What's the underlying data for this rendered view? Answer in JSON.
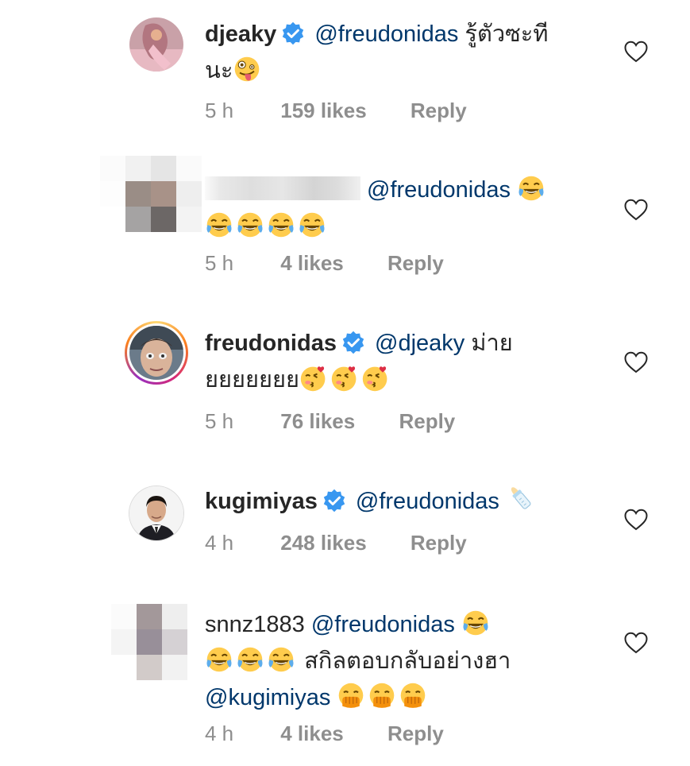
{
  "comments": [
    {
      "username": "djeaky",
      "verified": true,
      "mention": "@freudonidas",
      "text_line1": "รู้ตัวซะที",
      "text_line2": "นะ",
      "emoji": "zany-face",
      "time": "5 h",
      "likes": "159 likes",
      "reply": "Reply"
    },
    {
      "username": "",
      "verified": false,
      "mention": "@freudonidas",
      "emoji": "joy-face",
      "emoji_count": 5,
      "time": "5 h",
      "likes": "4 likes",
      "reply": "Reply"
    },
    {
      "username": "freudonidas",
      "verified": true,
      "mention": "@djeaky",
      "text_line1": "ม่าย",
      "text_line2": "ยยยยยยย",
      "emoji": "kissing-heart-face",
      "emoji_count": 3,
      "time": "5 h",
      "likes": "76 likes",
      "reply": "Reply"
    },
    {
      "username": "kugimiyas",
      "verified": true,
      "mention": "@freudonidas",
      "emoji": "baby-bottle",
      "time": "4 h",
      "likes": "248 likes",
      "reply": "Reply"
    },
    {
      "username": "snnz1883",
      "verified": false,
      "mention": "@freudonidas",
      "text_line2": "สกิลตอบกลับอย่างฮา",
      "mention2": "@kugimiyas",
      "emoji": "joy-face",
      "emoji2": "hand-over-mouth-face",
      "time": "4 h",
      "likes": "4 likes",
      "reply": "Reply"
    }
  ],
  "colors": {
    "text": "#262626",
    "mention": "#00376b",
    "meta": "#8e8e8e",
    "verified": "#3897f0"
  }
}
